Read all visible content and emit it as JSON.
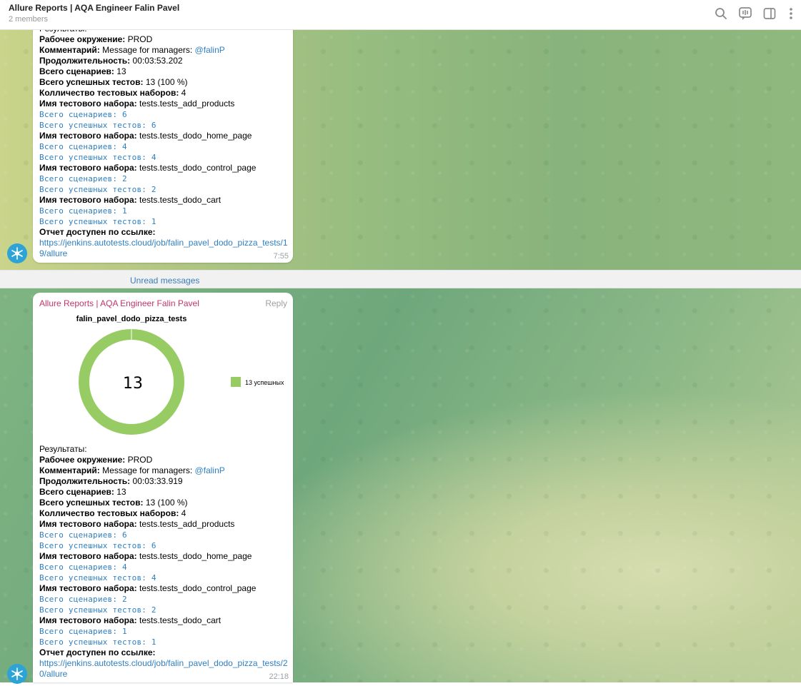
{
  "header": {
    "title": "Allure Reports | AQA Engineer Falin Pavel",
    "members": "2 members"
  },
  "divider": {
    "label": "Unread messages"
  },
  "messages": [
    {
      "time": "7:55",
      "lines": {
        "results": "Результаты:",
        "env_label": "Рабочее окружение:",
        "env_value": " PROD",
        "comment_label": "Комментарий:",
        "comment_value": " Message for managers: ",
        "comment_mention": "@falinP",
        "duration_label": "Продолжительность:",
        "duration_value": " 00:03:53.202",
        "total_label": "Всего сценариев:",
        "total_value": " 13",
        "passed_label": "Всего успешных тестов:",
        "passed_value": " 13 (100 %)",
        "suites_label": "Колличество тестовых наборов:",
        "suites_value": " 4"
      },
      "suites": [
        {
          "label": "Имя тестового набора:",
          "name": " tests.tests_add_products",
          "total": "Всего сценариев: 6",
          "passed": "Всего успешных тестов: 6"
        },
        {
          "label": "Имя тестового набора:",
          "name": " tests.tests_dodo_home_page",
          "total": "Всего сценариев: 4",
          "passed": "Всего успешных тестов: 4"
        },
        {
          "label": "Имя тестового набора:",
          "name": " tests.tests_dodo_control_page",
          "total": "Всего сценариев: 2",
          "passed": "Всего успешных тестов: 2"
        },
        {
          "label": "Имя тестового набора:",
          "name": " tests.tests_dodo_cart",
          "total": "Всего сценариев: 1",
          "passed": "Всего успешных тестов: 1"
        }
      ],
      "report_label": "Отчет доступен по ссылке:",
      "report_link_1": "https://jenkins.autotests.cloud/job/falin_pavel_dodo_pizza_tests/1",
      "report_link_2": "9/allure"
    },
    {
      "sender": "Allure Reports | AQA Engineer Falin Pavel",
      "reply": "Reply",
      "time": "22:18",
      "lines": {
        "results": "Результаты:",
        "env_label": "Рабочее окружение:",
        "env_value": " PROD",
        "comment_label": "Комментарий:",
        "comment_value": " Message for managers: ",
        "comment_mention": "@falinP",
        "duration_label": "Продолжительность:",
        "duration_value": " 00:03:33.919",
        "total_label": "Всего сценариев:",
        "total_value": " 13",
        "passed_label": "Всего успешных тестов:",
        "passed_value": " 13 (100 %)",
        "suites_label": "Колличество тестовых наборов:",
        "suites_value": " 4"
      },
      "suites": [
        {
          "label": "Имя тестового набора:",
          "name": " tests.tests_add_products",
          "total": "Всего сценариев: 6",
          "passed": "Всего успешных тестов: 6"
        },
        {
          "label": "Имя тестового набора:",
          "name": " tests.tests_dodo_home_page",
          "total": "Всего сценариев: 4",
          "passed": "Всего успешных тестов: 4"
        },
        {
          "label": "Имя тестового набора:",
          "name": " tests.tests_dodo_control_page",
          "total": "Всего сценариев: 2",
          "passed": "Всего успешных тестов: 2"
        },
        {
          "label": "Имя тестового набора:",
          "name": " tests.tests_dodo_cart",
          "total": "Всего сценариев: 1",
          "passed": "Всего успешных тестов: 1"
        }
      ],
      "report_label": "Отчет доступен по ссылке:",
      "report_link_1": "https://jenkins.autotests.cloud/job/falin_pavel_dodo_pizza_tests/2",
      "report_link_2": "0/allure"
    }
  ],
  "chart_data": {
    "type": "pie",
    "title": "falin_pavel_dodo_pizza_tests",
    "center_label": "13",
    "categories": [
      "13 успешных"
    ],
    "values": [
      13
    ],
    "colors": [
      "#97cc64"
    ]
  },
  "icons": [
    "search-icon",
    "voice-chat-icon",
    "sidebar-toggle-icon",
    "more-vertical-icon",
    "bot-avatar-icon"
  ],
  "colors": {
    "link": "#2f7fc1",
    "sender": "#c2356a",
    "chart_fill": "#97cc64",
    "avatar": "#2da3d6"
  }
}
